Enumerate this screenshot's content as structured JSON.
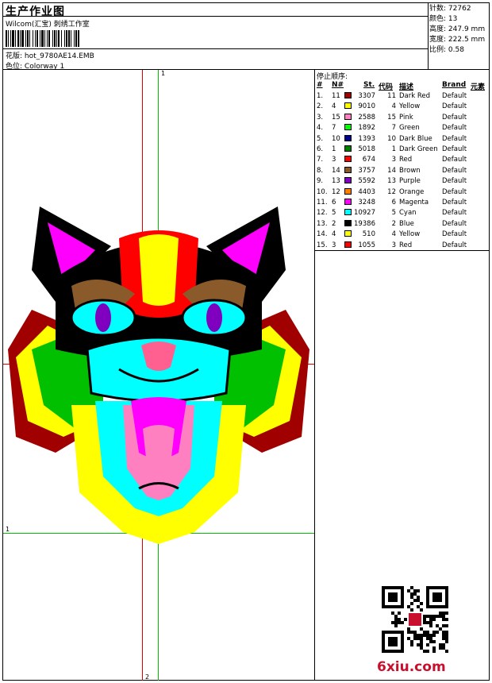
{
  "header": {
    "title": "生产作业图",
    "company": "Wilcom(汇宝) 刺绣工作室",
    "design_label": "花版:",
    "design_value": "hot_9780AE14.EMB",
    "colorway_label": "色位:",
    "colorway_value": "Colorway 1"
  },
  "stats": [
    {
      "label": "针数:",
      "value": "72762"
    },
    {
      "label": "颜色:",
      "value": "13"
    },
    {
      "label": "高度:",
      "value": "247.9 mm"
    },
    {
      "label": "宽度:",
      "value": "222.5 mm"
    },
    {
      "label": "比例:",
      "value": "0.58"
    }
  ],
  "stop_sequence": {
    "title": "停止顺序:",
    "columns": [
      "#",
      "N#",
      "St.",
      "代码",
      "描述",
      "Brand",
      "元素"
    ],
    "rows": [
      {
        "idx": "1.",
        "n": "11",
        "color": "#a00000",
        "st": "3307",
        "code": "11",
        "desc": "Dark Red",
        "brand": "Default"
      },
      {
        "idx": "2.",
        "n": "4",
        "color": "#ffff00",
        "st": "9010",
        "code": "4",
        "desc": "Yellow",
        "brand": "Default"
      },
      {
        "idx": "3.",
        "n": "15",
        "color": "#ff80c0",
        "st": "2588",
        "code": "15",
        "desc": "Pink",
        "brand": "Default"
      },
      {
        "idx": "4.",
        "n": "7",
        "color": "#00ff00",
        "st": "1892",
        "code": "7",
        "desc": "Green",
        "brand": "Default"
      },
      {
        "idx": "5.",
        "n": "10",
        "color": "#000090",
        "st": "1393",
        "code": "10",
        "desc": "Dark Blue",
        "brand": "Default"
      },
      {
        "idx": "6.",
        "n": "1",
        "color": "#008000",
        "st": "5018",
        "code": "1",
        "desc": "Dark Green",
        "brand": "Default"
      },
      {
        "idx": "7.",
        "n": "3",
        "color": "#ff0000",
        "st": "674",
        "code": "3",
        "desc": "Red",
        "brand": "Default"
      },
      {
        "idx": "8.",
        "n": "14",
        "color": "#8b5a2b",
        "st": "3757",
        "code": "14",
        "desc": "Brown",
        "brand": "Default"
      },
      {
        "idx": "9.",
        "n": "13",
        "color": "#8000c0",
        "st": "5592",
        "code": "13",
        "desc": "Purple",
        "brand": "Default"
      },
      {
        "idx": "10.",
        "n": "12",
        "color": "#ff8000",
        "st": "4403",
        "code": "12",
        "desc": "Orange",
        "brand": "Default"
      },
      {
        "idx": "11.",
        "n": "6",
        "color": "#ff00ff",
        "st": "3248",
        "code": "6",
        "desc": "Magenta",
        "brand": "Default"
      },
      {
        "idx": "12.",
        "n": "5",
        "color": "#00ffff",
        "st": "10927",
        "code": "5",
        "desc": "Cyan",
        "brand": "Default"
      },
      {
        "idx": "13.",
        "n": "2",
        "color": "#000000",
        "st": "19386",
        "code": "2",
        "desc": "Blue",
        "brand": "Default"
      },
      {
        "idx": "14.",
        "n": "4",
        "color": "#ffff00",
        "st": "510",
        "code": "4",
        "desc": "Yellow",
        "brand": "Default"
      },
      {
        "idx": "15.",
        "n": "3",
        "color": "#ff0000",
        "st": "1055",
        "code": "3",
        "desc": "Red",
        "brand": "Default"
      }
    ]
  },
  "guides": {
    "top_label": "1",
    "left_label": "1",
    "bottom_label": "2"
  },
  "watermark": "6xiu.com",
  "colors": {
    "guide_red": "#e00000",
    "guide_green": "#00c000"
  }
}
